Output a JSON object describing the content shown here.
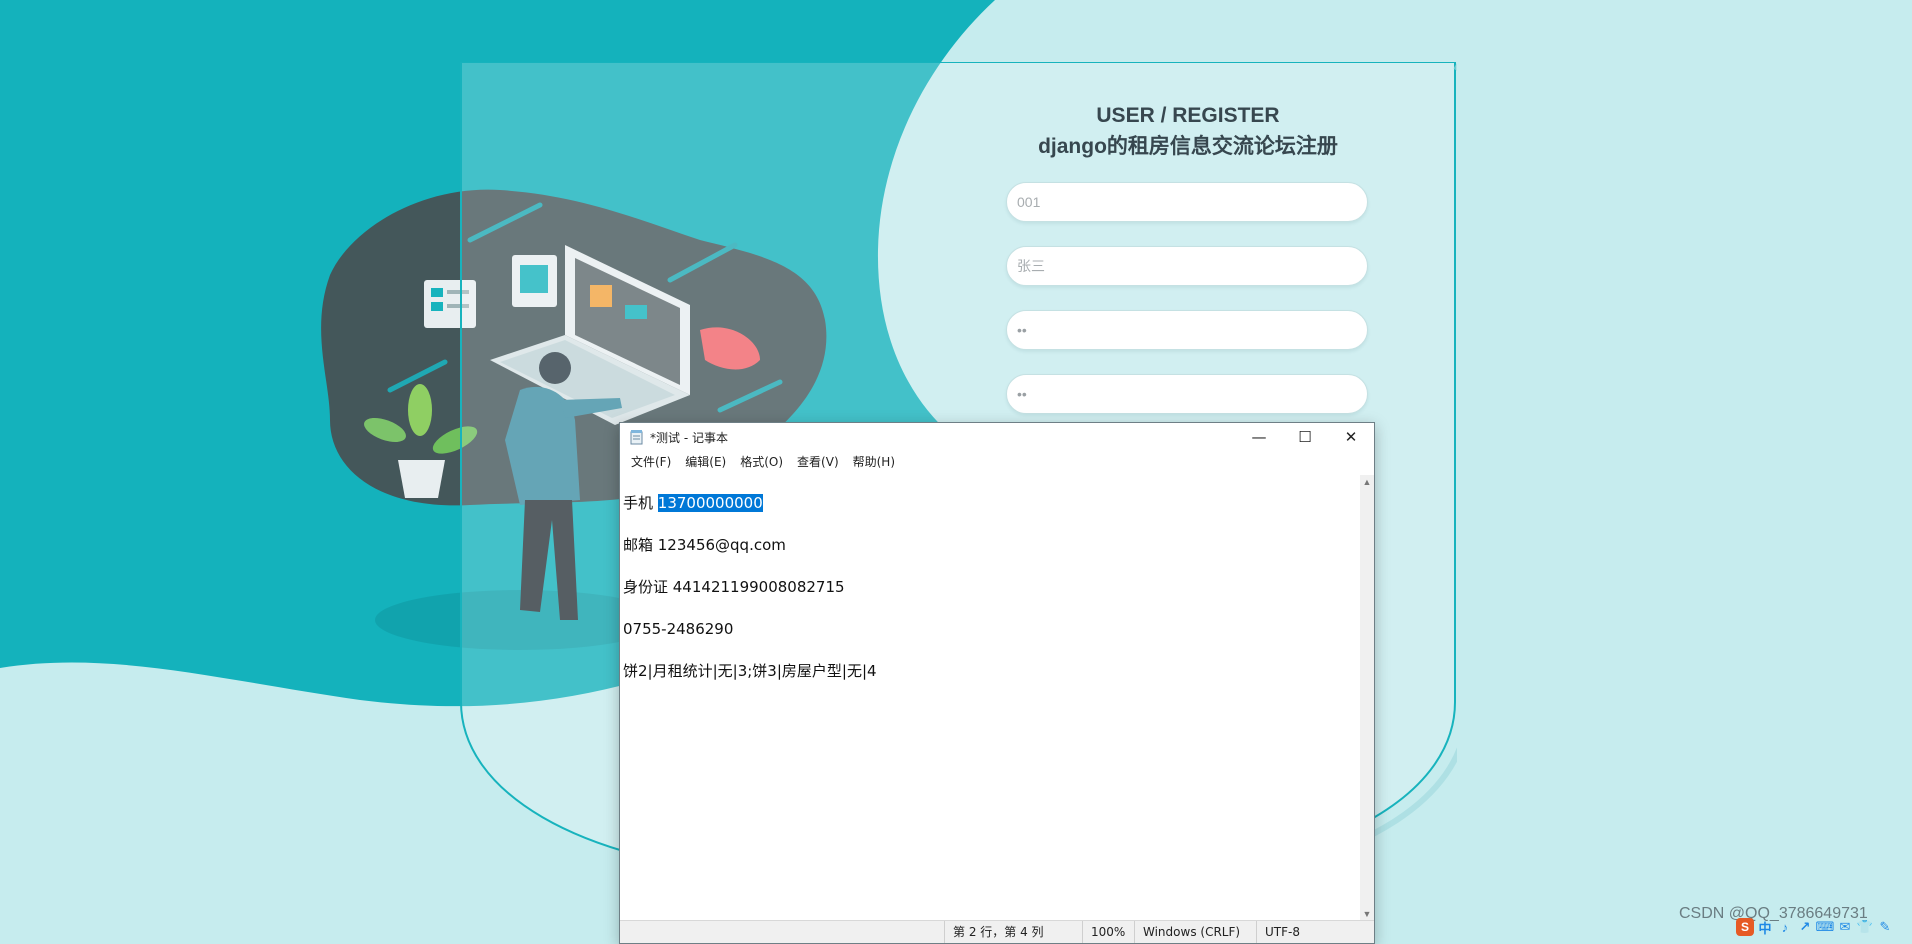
{
  "form": {
    "title_en": "USER / REGISTER",
    "title_cn": "django的租房信息交流论坛注册",
    "fields": [
      {
        "value": "",
        "placeholder": "001"
      },
      {
        "value": "",
        "placeholder": "张三"
      },
      {
        "value": "••",
        "placeholder": ""
      },
      {
        "value": "••",
        "placeholder": ""
      }
    ]
  },
  "notepad": {
    "title": "*测试 - 记事本",
    "menu": [
      "文件(F)",
      "编辑(E)",
      "格式(O)",
      "查看(V)",
      "帮助(H)"
    ],
    "lines": {
      "phone_label": "手机 ",
      "phone_selected": "13700000000",
      "email": "邮箱 123456@qq.com",
      "idcard": "身份证 441421199008082715",
      "tel": "0755-2486290",
      "blank": "",
      "chart": "饼2|月租统计|无|3;饼3|房屋户型|无|4"
    },
    "status": {
      "position": "第 2 行，第 4 列",
      "zoom": "100%",
      "line_ending": "Windows (CRLF)",
      "encoding": "UTF-8"
    },
    "buttons": {
      "minimize": "—",
      "maximize": "☐",
      "close": "✕"
    }
  },
  "watermark": "CSDN @QQ_3786649731",
  "tray": {
    "s": "S",
    "items": [
      "中",
      "♪",
      "↗",
      "⌨",
      "✉",
      "👕",
      "✎"
    ]
  },
  "colors": {
    "teal": "#17b3bd",
    "light": "#c6ecee",
    "dark_blob": "#4a5556",
    "selection": "#0078d7"
  }
}
